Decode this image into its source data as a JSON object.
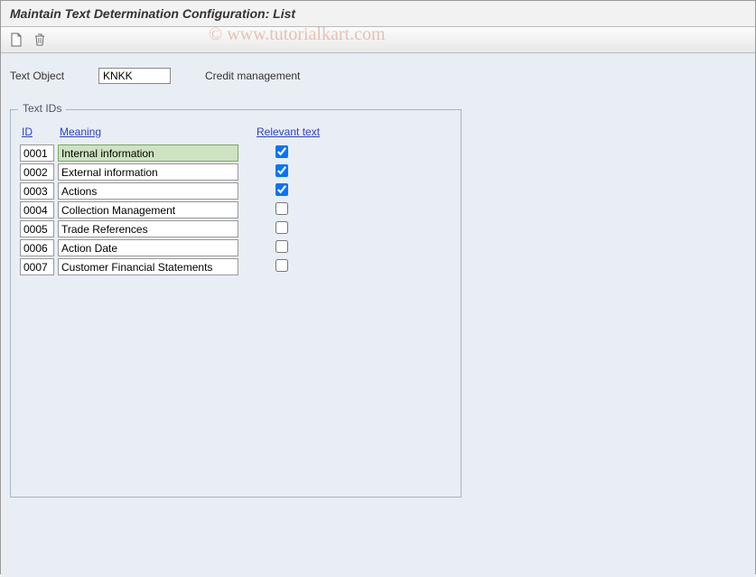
{
  "title": "Maintain Text Determination Configuration: List",
  "watermark": "© www.tutorialkart.com",
  "textObject": {
    "label": "Text Object",
    "value": "KNKK",
    "description": "Credit management"
  },
  "group": {
    "title": "Text IDs",
    "headers": {
      "id": "ID",
      "meaning": "Meaning",
      "relevant": "Relevant text"
    },
    "rows": [
      {
        "id": "0001",
        "meaning": "Internal information",
        "relevant": true,
        "selected": true
      },
      {
        "id": "0002",
        "meaning": "External information",
        "relevant": true,
        "selected": false
      },
      {
        "id": "0003",
        "meaning": "Actions",
        "relevant": true,
        "selected": false
      },
      {
        "id": "0004",
        "meaning": "Collection Management",
        "relevant": false,
        "selected": false
      },
      {
        "id": "0005",
        "meaning": "Trade References",
        "relevant": false,
        "selected": false
      },
      {
        "id": "0006",
        "meaning": "Action Date",
        "relevant": false,
        "selected": false
      },
      {
        "id": "0007",
        "meaning": "Customer Financial Statements",
        "relevant": false,
        "selected": false
      }
    ]
  }
}
